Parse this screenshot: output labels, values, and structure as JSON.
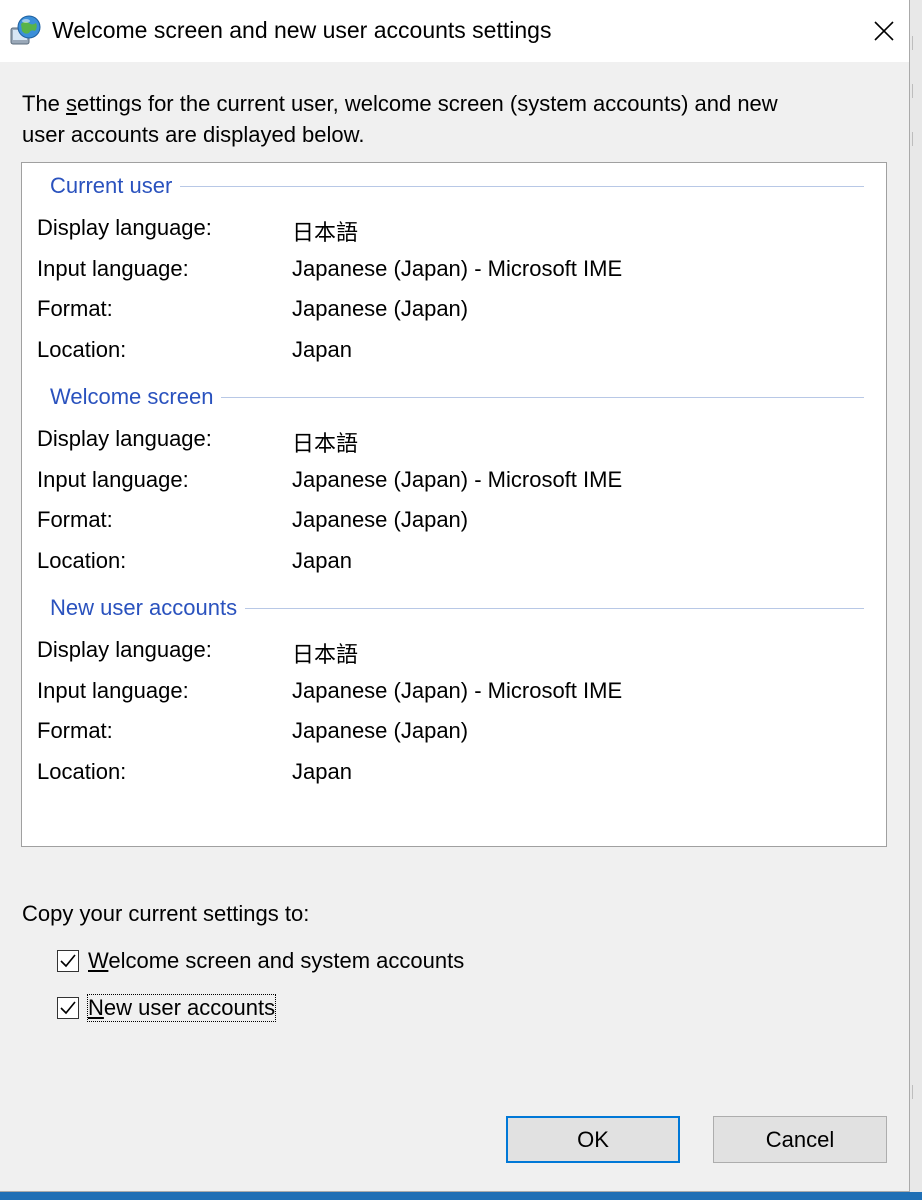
{
  "window": {
    "title": "Welcome screen and new user accounts settings",
    "close_label": "✕"
  },
  "description": {
    "prefix": "The ",
    "mnemonic": "s",
    "rest_line1": "ettings for the current user, welcome screen (system accounts) and new",
    "line2": "user accounts are displayed below."
  },
  "sections": [
    {
      "title": "Current user",
      "rows": [
        {
          "key": "Display language:",
          "value": "日本語"
        },
        {
          "key": "Input language:",
          "value": "Japanese (Japan) - Microsoft IME"
        },
        {
          "key": "Format:",
          "value": "Japanese (Japan)"
        },
        {
          "key": "Location:",
          "value": "Japan"
        }
      ]
    },
    {
      "title": "Welcome screen",
      "rows": [
        {
          "key": "Display language:",
          "value": "日本語"
        },
        {
          "key": "Input language:",
          "value": "Japanese (Japan) - Microsoft IME"
        },
        {
          "key": "Format:",
          "value": "Japanese (Japan)"
        },
        {
          "key": "Location:",
          "value": "Japan"
        }
      ]
    },
    {
      "title": "New user accounts",
      "rows": [
        {
          "key": "Display language:",
          "value": "日本語"
        },
        {
          "key": "Input language:",
          "value": "Japanese (Japan) - Microsoft IME"
        },
        {
          "key": "Format:",
          "value": "Japanese (Japan)"
        },
        {
          "key": "Location:",
          "value": "Japan"
        }
      ]
    }
  ],
  "copy": {
    "label": "Copy your current settings to:",
    "options": [
      {
        "mnemonic": "W",
        "rest": "elcome screen and system accounts",
        "checked": true
      },
      {
        "mnemonic": "N",
        "rest": "ew user accounts",
        "checked": true
      }
    ]
  },
  "buttons": {
    "ok": "OK",
    "cancel": "Cancel"
  },
  "colors": {
    "section_title": "#2a52be",
    "default_button_border": "#0078d7",
    "taskbar_accent": "#1f6fb5"
  }
}
